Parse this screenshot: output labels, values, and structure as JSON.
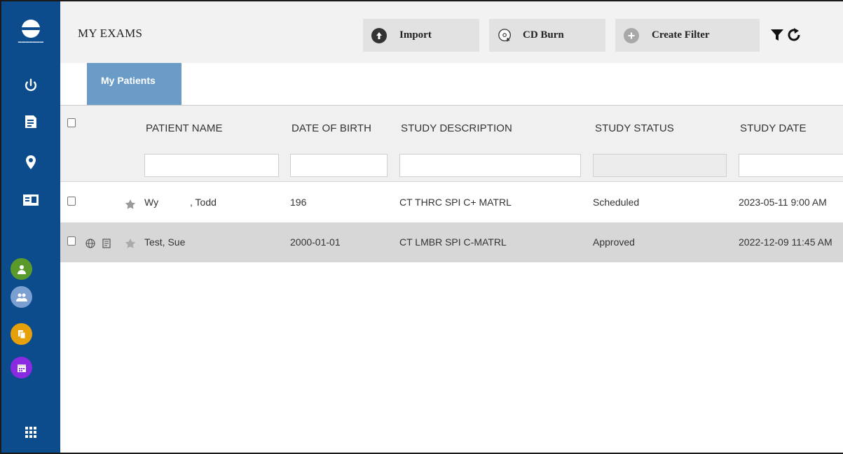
{
  "header": {
    "title": "MY EXAMS",
    "import_label": "Import",
    "cd_burn_label": "CD Burn",
    "create_filter_label": "Create Filter"
  },
  "tabs": [
    {
      "label": "My Patients"
    }
  ],
  "table": {
    "columns": [
      "PATIENT NAME",
      "DATE OF BIRTH",
      "STUDY DESCRIPTION",
      "STUDY STATUS",
      "STUDY DATE"
    ],
    "rows": [
      {
        "patient_first": "Wy",
        "patient_last": ", Todd",
        "dob": "196",
        "description": "CT THRC SPI C+ MATRL",
        "status": "Scheduled",
        "date": "2023-05-11 9:00 AM"
      },
      {
        "patient_first": "Test, Sue",
        "patient_last": "",
        "dob": "2000-01-01",
        "description": "CT LMBR SPI C-MATRL",
        "status": "Approved",
        "date": "2022-12-09 11:45 AM"
      }
    ]
  },
  "icons": [
    "power-icon",
    "document-icon",
    "location-pin-icon",
    "id-card-icon",
    "user-icon",
    "group-icon",
    "copy-icon",
    "calendar-icon",
    "apps-grid-icon",
    "filter-icon",
    "refresh-icon",
    "import-icon",
    "cd-burn-icon",
    "add-icon",
    "star-icon",
    "globe-icon",
    "report-icon"
  ],
  "colors": {
    "sidebar": "#0d4c8c",
    "tab": "#6b9cc7",
    "user_btn": "#5a9a2a",
    "group_btn": "#7b9fd0",
    "copy_btn": "#e6a00a",
    "calendar_btn": "#8a2be2"
  }
}
